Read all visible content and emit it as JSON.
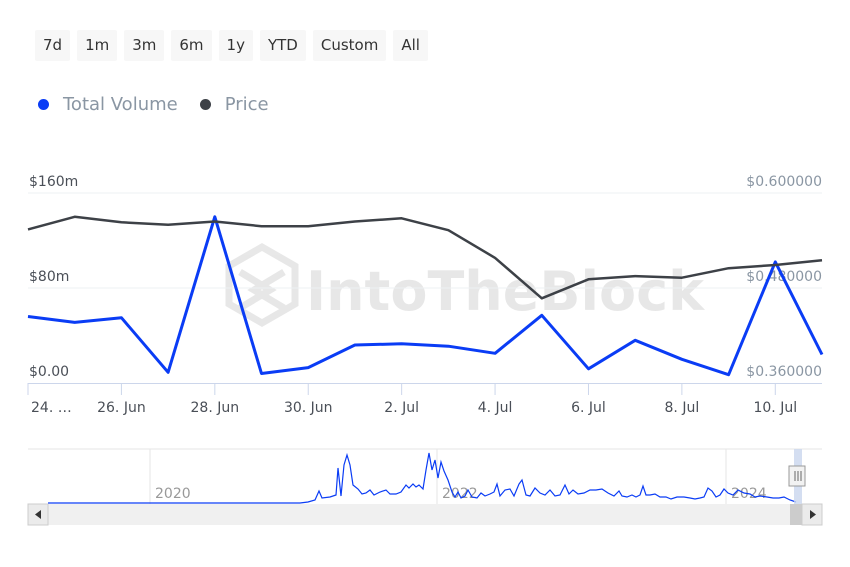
{
  "range_selector": {
    "buttons": [
      "7d",
      "1m",
      "3m",
      "6m",
      "1y",
      "YTD",
      "Custom",
      "All"
    ]
  },
  "legend": {
    "items": [
      {
        "label": "Total Volume",
        "color": "#0a3cf5"
      },
      {
        "label": "Price",
        "color": "#3d4147"
      }
    ]
  },
  "watermark": "IntoTheBlock",
  "chart_data": {
    "type": "line",
    "title": "",
    "x": [
      "24 Jun",
      "25 Jun",
      "26 Jun",
      "27 Jun",
      "28 Jun",
      "29 Jun",
      "30 Jun",
      "1 Jul",
      "2 Jul",
      "3 Jul",
      "4 Jul",
      "5 Jul",
      "6 Jul",
      "7 Jul",
      "8 Jul",
      "9 Jul",
      "10 Jul",
      "11 Jul"
    ],
    "x_tick_labels": [
      "24. …",
      "26. Jun",
      "28. Jun",
      "30. Jun",
      "2. Jul",
      "4. Jul",
      "6. Jul",
      "8. Jul",
      "10. Jul"
    ],
    "series": [
      {
        "name": "Total Volume",
        "axis": "left",
        "color": "#0a3cf5",
        "unit": "USD millions",
        "values": [
          56,
          51,
          55,
          9,
          140,
          8,
          13,
          32,
          33,
          31,
          25,
          57,
          12,
          36,
          20,
          7,
          102,
          24
        ]
      },
      {
        "name": "Price",
        "axis": "right",
        "color": "#3d4147",
        "unit": "USD",
        "values": [
          0.554,
          0.57,
          0.563,
          0.56,
          0.564,
          0.558,
          0.558,
          0.564,
          0.568,
          0.553,
          0.518,
          0.467,
          0.491,
          0.495,
          0.493,
          0.505,
          0.509,
          0.515
        ]
      }
    ],
    "y_left": {
      "ticks": [
        "$0.00",
        "$80m",
        "$160m"
      ],
      "tick_values": [
        0,
        80,
        160
      ],
      "range": [
        0,
        160
      ]
    },
    "y_right": {
      "ticks": [
        "$0.360000",
        "$0.480000",
        "$0.600000"
      ],
      "tick_values": [
        0.36,
        0.48,
        0.6
      ],
      "range": [
        0.36,
        0.6
      ]
    },
    "grid": true,
    "legend_position": "top-left",
    "navigator": {
      "year_labels": [
        "2020",
        "2022",
        "2024"
      ],
      "series_name": "Total Volume"
    }
  }
}
